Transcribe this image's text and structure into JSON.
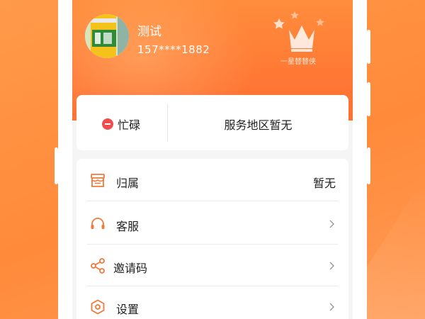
{
  "user": {
    "name": "测试",
    "phone": "157****1882",
    "level": "一星替替侠"
  },
  "status": {
    "busy_label": "忙碌",
    "region_label": "服务地区暂无"
  },
  "menu": {
    "items": [
      {
        "label": "归属",
        "value": "暂无",
        "icon": "store-icon"
      },
      {
        "label": "客服",
        "value": "",
        "icon": "headset-icon"
      },
      {
        "label": "邀请码",
        "value": "",
        "icon": "share-icon"
      },
      {
        "label": "设置",
        "value": "",
        "icon": "settings-icon"
      }
    ]
  },
  "colors": {
    "accent": "#ff7a35",
    "icon": "#f07a3a",
    "busy": "#f04e4e"
  }
}
